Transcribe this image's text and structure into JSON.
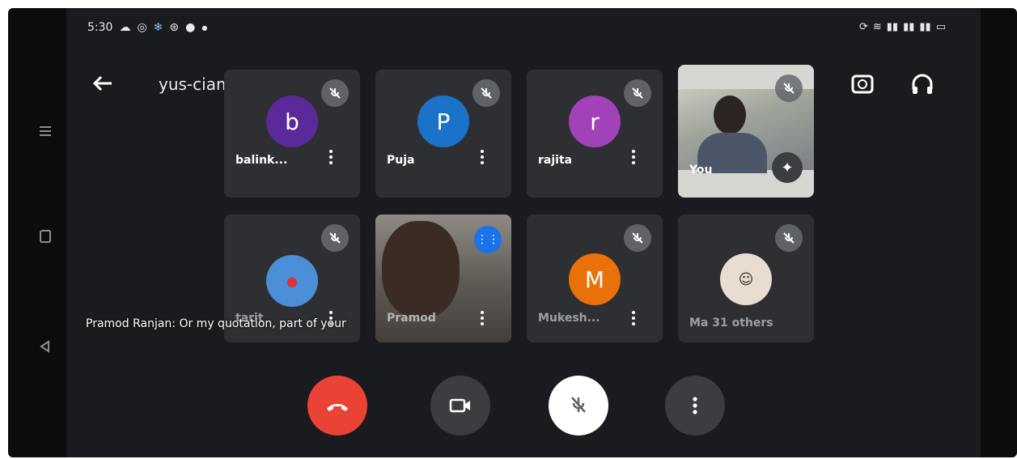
{
  "status_bar": {
    "time": "5:30",
    "left_icons": [
      "cloud-icon",
      "whatsapp-icon",
      "snowflake-icon",
      "app-icon",
      "chat-icon",
      "dot-icon"
    ],
    "right_icons": [
      "sync-icon",
      "wifi-icon",
      "signal-icon",
      "signal-icon",
      "signal-icon",
      "battery-icon"
    ]
  },
  "header": {
    "meeting_code": "yus-ciam-hqz",
    "back_icon": "arrow-left-icon",
    "actions": [
      "switch-camera-icon",
      "headphones-icon"
    ]
  },
  "participants": [
    {
      "name": "balink...",
      "initial": "b",
      "avatar_color": "#5b2a9a",
      "muted": true
    },
    {
      "name": "Puja",
      "initial": "P",
      "avatar_color": "#1a73c8",
      "muted": true
    },
    {
      "name": "rajita",
      "initial": "r",
      "avatar_color": "#a142b8",
      "muted": true
    },
    {
      "name": "You",
      "muted": true,
      "video": true
    },
    {
      "name": "tarit",
      "muted": true,
      "photo": true
    },
    {
      "name": "Pramod",
      "speaking": true,
      "video": true
    },
    {
      "name": "Mukesh...",
      "initial": "M",
      "avatar_color": "#e8710a",
      "muted": true
    },
    {
      "name": "Ma",
      "extra": "31 others",
      "muted": true,
      "photo": true
    }
  ],
  "caption": "Pramod Ranjan: Or my quotation, part of your",
  "controls": {
    "end_call_color": "#ea4335",
    "items": [
      "end-call-icon",
      "camera-icon",
      "mic-off-icon",
      "more-icon"
    ]
  }
}
